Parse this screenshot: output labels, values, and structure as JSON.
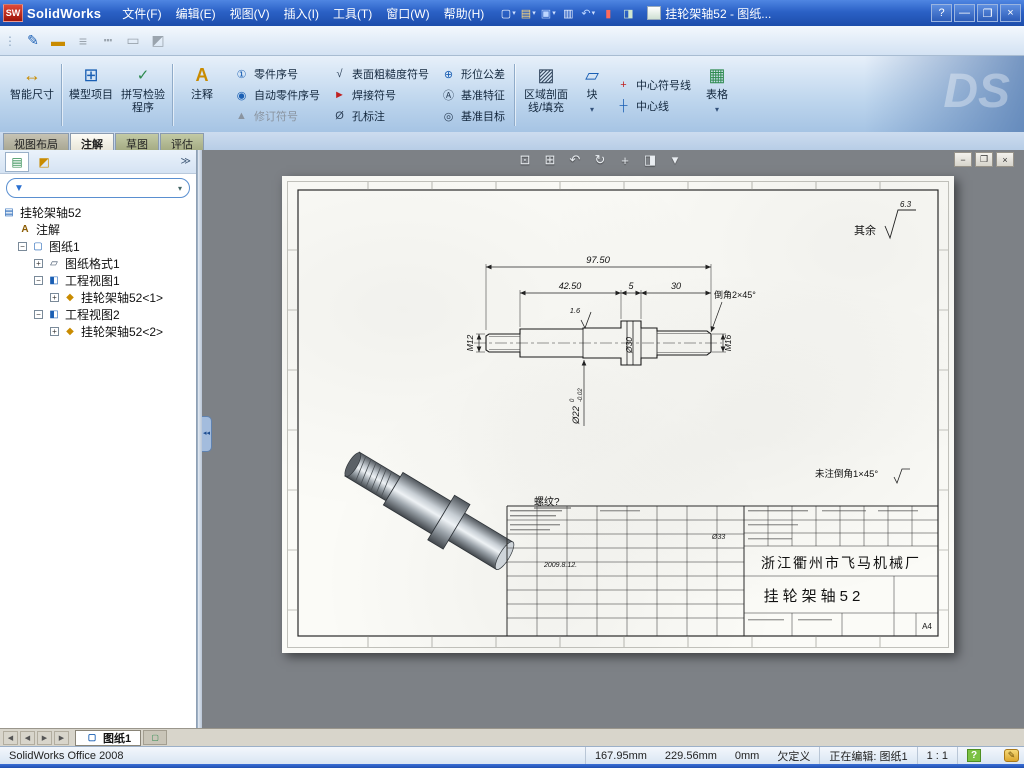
{
  "titlebar": {
    "app_name": "SolidWorks",
    "logo_text": "SW",
    "menus": [
      "文件(F)",
      "编辑(E)",
      "视图(V)",
      "插入(I)",
      "工具(T)",
      "窗口(W)",
      "帮助(H)"
    ],
    "doc_title": "挂轮架轴52 - 图纸..."
  },
  "ribbon": {
    "smart_dimension": "智能尺寸",
    "model_items": "模型项目",
    "spell_checker": "拼写检验程序",
    "note": "注释",
    "balloon": "零件序号",
    "auto_balloon": "自动零件序号",
    "revision_symbol": "修订符号",
    "surface_finish": "表面粗糙度符号",
    "weld_symbol": "焊接符号",
    "hole_callout": "孔标注",
    "geo_tolerance": "形位公差",
    "datum_feature": "基准特征",
    "datum_target": "基准目标",
    "area_hatch": "区域剖面线/填充",
    "block": "块",
    "center_mark": "中心符号线",
    "centerline": "中心线",
    "tables": "表格",
    "watermark": "DS"
  },
  "cmd_tabs": [
    "视图布局",
    "注解",
    "草图",
    "评估"
  ],
  "tree": {
    "root": "挂轮架轴52",
    "items": [
      {
        "label": "注解"
      },
      {
        "label": "图纸1"
      },
      {
        "label": "图纸格式1"
      },
      {
        "label": "工程视图1"
      },
      {
        "label": "挂轮架轴52<1>"
      },
      {
        "label": "工程视图2"
      },
      {
        "label": "挂轮架轴52<2>"
      }
    ]
  },
  "drawing": {
    "dim_overall": "97.50",
    "dim_a": "42.50",
    "dim_b": "5",
    "dim_c": "30",
    "thread_left": "M12",
    "thread_right": "M16",
    "dia_flange": "Ø30",
    "dia_mid": "Ø22",
    "tol_upper": "0",
    "tol_lower": "-0.02",
    "finish_value": "1.6",
    "chamfer_note": "倒角2×45°",
    "rest_label": "其余",
    "rest_value": "6.3",
    "unnoted_chamfer": "未注倒角1×45°",
    "thread_query": "螺纹?",
    "company": "浙江衢州市飞马机械厂",
    "part_name": "挂轮架轴52",
    "paper_size": "A4",
    "date": "2009.8.12.",
    "misc_dia": "Ø33"
  },
  "sheet_bar": {
    "tab": "图纸1"
  },
  "status": {
    "left": "SolidWorks Office 2008",
    "x": "167.95mm",
    "y": "229.56mm",
    "z": "0mm",
    "state": "欠定义",
    "editing": "正在编辑: 图纸1",
    "scale": "1 : 1"
  },
  "icons": {
    "caret": "▾",
    "new_doc": "▢",
    "open": "▤",
    "save": "▣",
    "print": "▥",
    "undo": "↶",
    "toolbox": "▮",
    "task_pane": "◨",
    "sketch": "✎",
    "line_color": "▬",
    "line_style": "┅",
    "line_width": "≡",
    "hide_edge": "▭",
    "shaded": "◩",
    "smart_dim": "↔",
    "model_items": "⊞",
    "spell": "✓",
    "note": "A",
    "balloon": "①",
    "auto_balloon": "◉",
    "revision": "▲",
    "surface": "√",
    "weld": "►",
    "hole": "Ø",
    "geotol": "⊕",
    "datum": "Ⓐ",
    "target": "◎",
    "hatch": "▨",
    "block": "▱",
    "center_mark": "+",
    "centerline": "┼",
    "table": "▦",
    "funnel": "▼",
    "chevrons": "≫",
    "plus": "+",
    "minus": "−",
    "zoom_fit": "⊡",
    "zoom_area": "⊞",
    "prev_view": "↶",
    "rotate": "↻",
    "pan": "+",
    "display": "◨",
    "dd": "▾",
    "win_min": "—",
    "win_restore": "❐",
    "win_close": "×",
    "help": "?",
    "doc_min": "−",
    "doc_restore": "❐",
    "doc_close": "×",
    "nav_first": "◀",
    "nav_prev": "◀",
    "nav_next": "▶",
    "nav_last": "▶",
    "add_sheet": "▢",
    "tree_root": "▤",
    "tree_note": "A",
    "tree_sheet": "▢",
    "tree_format": "▱",
    "tree_view": "◧",
    "tree_part": "◆",
    "q_help": "?",
    "tip": "✎",
    "grip": "⋮",
    "collapse": "◂◂"
  }
}
